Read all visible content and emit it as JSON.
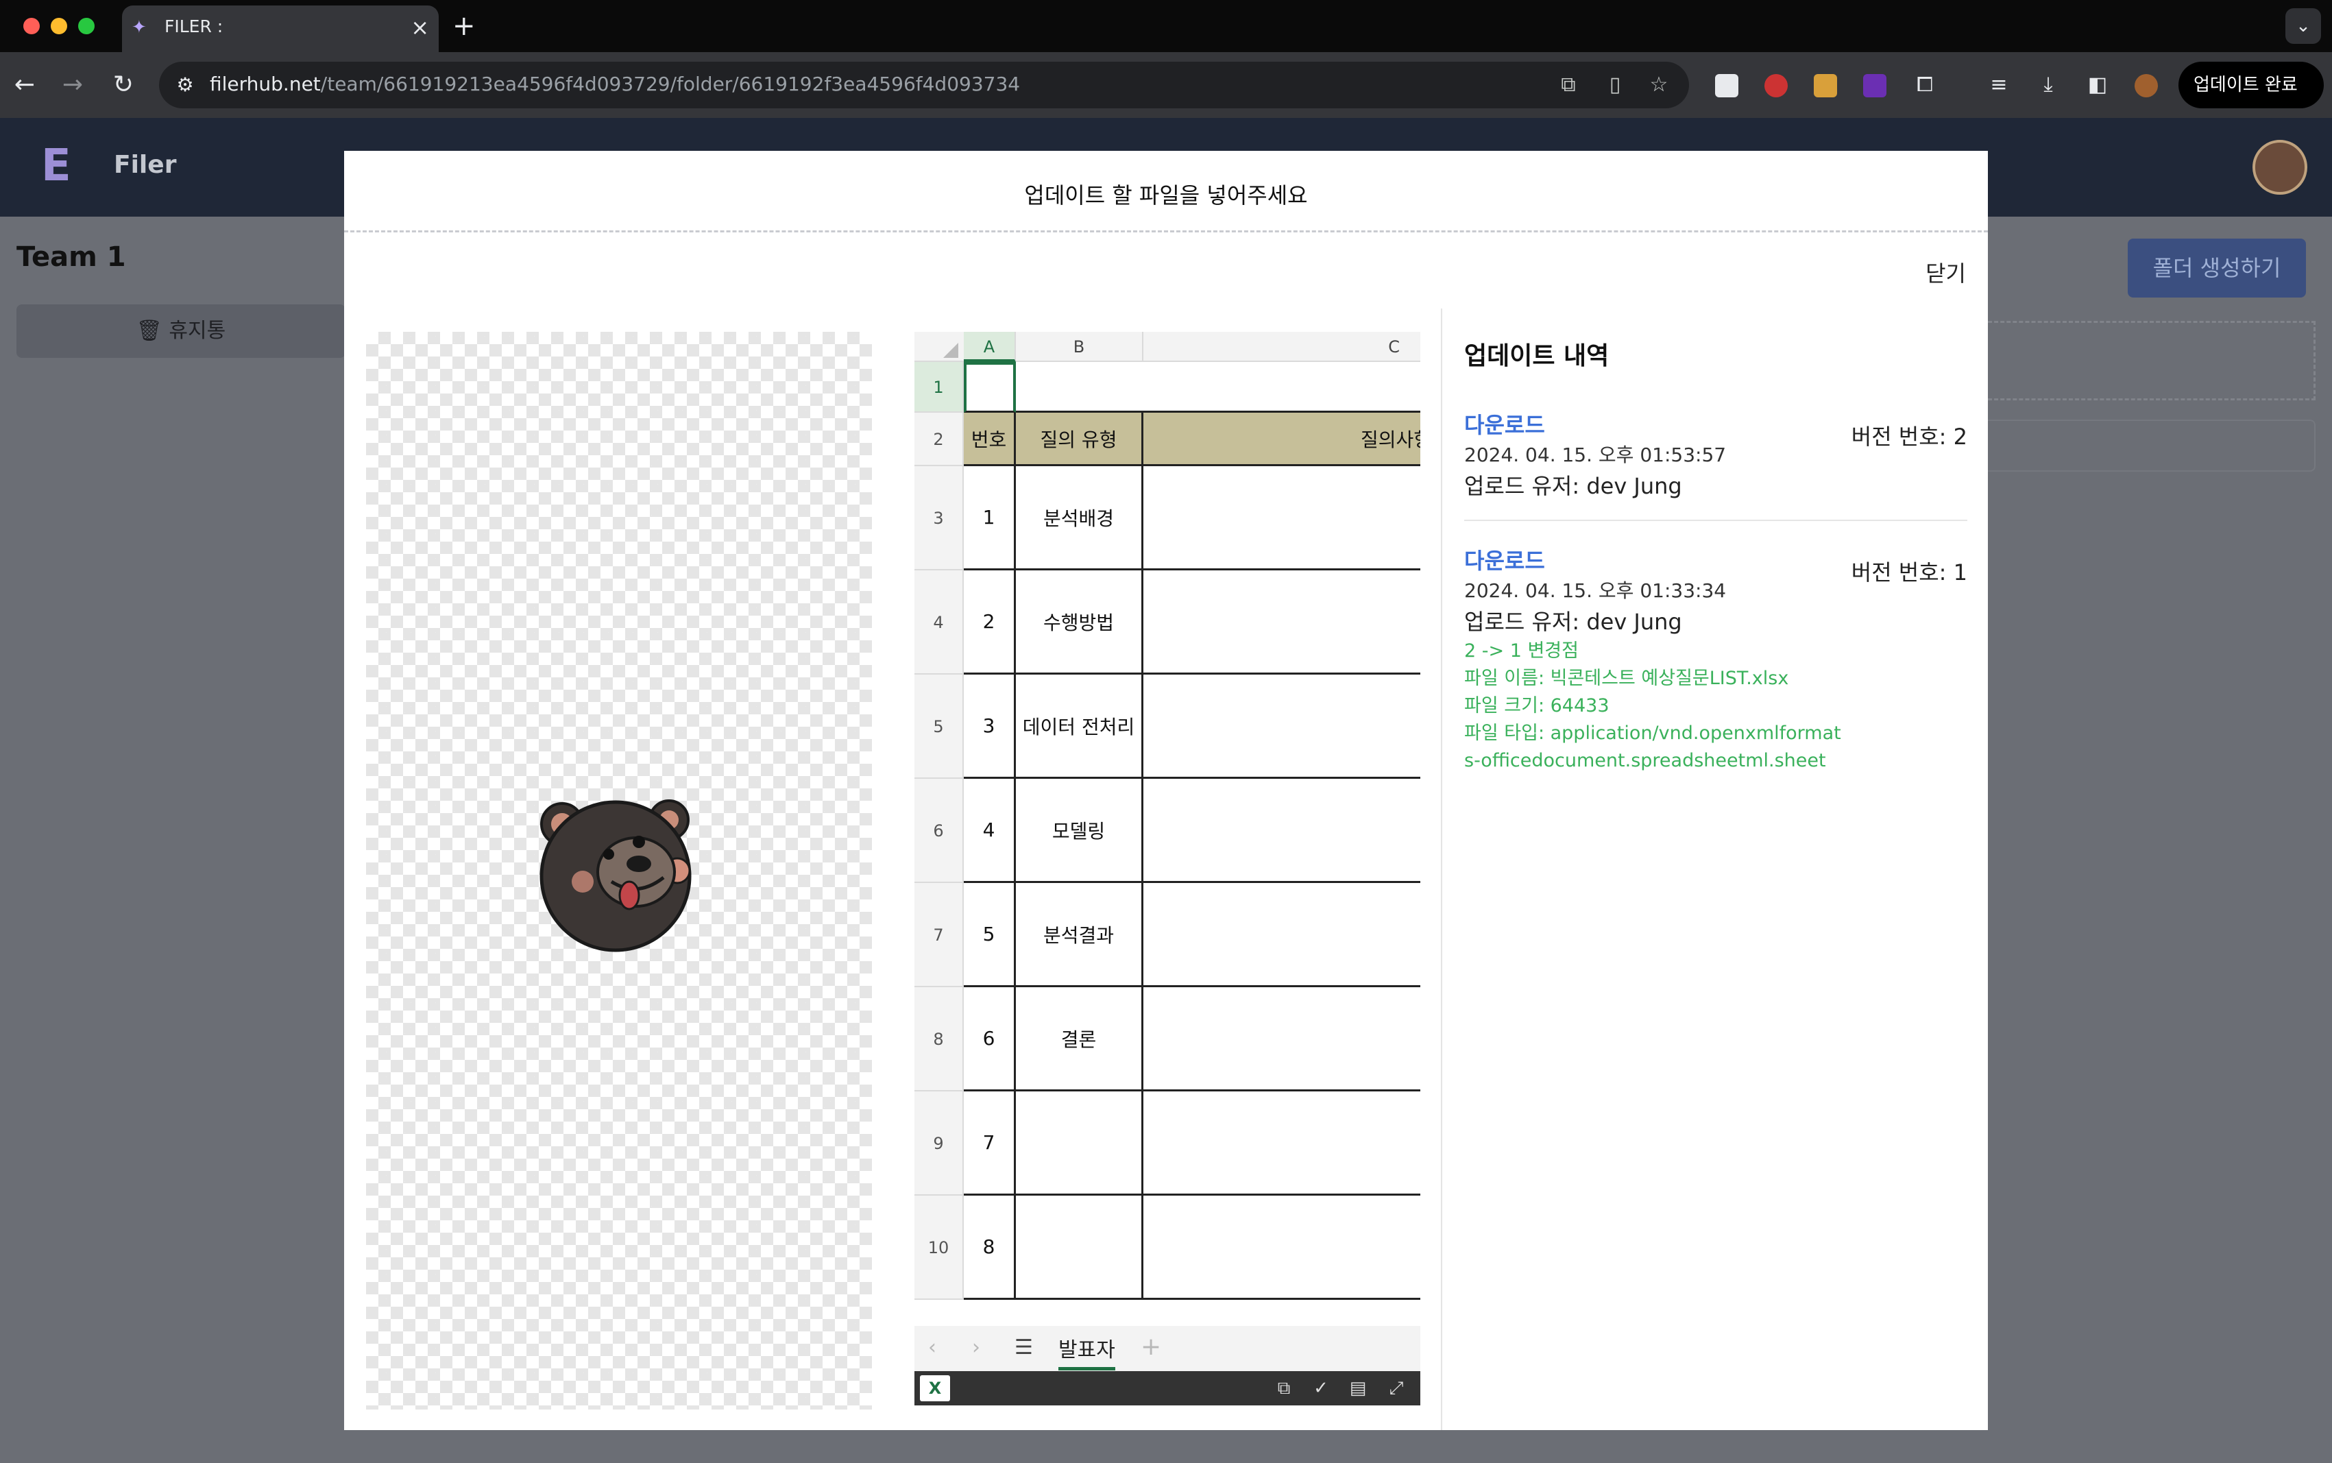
{
  "browser": {
    "tab_title": "FILER :",
    "url_host": "filerhub.net",
    "url_path": "/team/661919213ea4596f4d093729/folder/6619192f3ea4596f4d093734",
    "update_button_label": "업데이트 완료"
  },
  "app": {
    "name": "Filer",
    "team_title": "Team 1",
    "trash_label": "휴지통",
    "create_folder_label": "폴더 생성하기"
  },
  "modal": {
    "title": "업데이트 할 파일을 넣어주세요",
    "close_label": "닫기"
  },
  "sheet": {
    "columns": [
      "A",
      "B",
      "C"
    ],
    "rows": [
      {
        "row": "1",
        "num": "",
        "type": "",
        "question": ""
      },
      {
        "row": "2",
        "num": "번호",
        "type": "질의 유형",
        "question": "질의사항"
      },
      {
        "row": "3",
        "num": "1",
        "type": "분석배경",
        "question": ""
      },
      {
        "row": "4",
        "num": "2",
        "type": "수행방법",
        "question": ""
      },
      {
        "row": "5",
        "num": "3",
        "type": "데이터 전처리",
        "question": ""
      },
      {
        "row": "6",
        "num": "4",
        "type": "모델링",
        "question": ""
      },
      {
        "row": "7",
        "num": "5",
        "type": "분석결과",
        "question": ""
      },
      {
        "row": "8",
        "num": "6",
        "type": "결론",
        "question": ""
      },
      {
        "row": "9",
        "num": "7",
        "type": "",
        "question": ""
      },
      {
        "row": "10",
        "num": "8",
        "type": "",
        "question": ""
      }
    ],
    "active_tab": "발표자"
  },
  "history": {
    "title": "업데이트 내역",
    "entries": [
      {
        "download_label": "다운로드",
        "version_label": "버전 번호: 2",
        "date": "2024. 04. 15. 오후 01:53:57",
        "uploader": "업로드 유저: dev Jung"
      },
      {
        "download_label": "다운로드",
        "version_label": "버전 번호: 1",
        "date": "2024. 04. 15. 오후 01:33:34",
        "uploader": "업로드 유저: dev Jung",
        "changes": {
          "heading": "2 -> 1 변경점",
          "file_name": "파일 이름: 빅콘테스트 예상질문LIST.xlsx",
          "file_size": "파일 크기: 64433",
          "file_type": "파일 타입: application/vnd.openxmlformats-officedocument.spreadsheetml.sheet"
        }
      }
    ]
  },
  "colors": {
    "accent_link": "#3b6fd8",
    "change_green": "#3ab15b",
    "sheet_header": "#c6bf99",
    "excel_green": "#1f7244"
  }
}
